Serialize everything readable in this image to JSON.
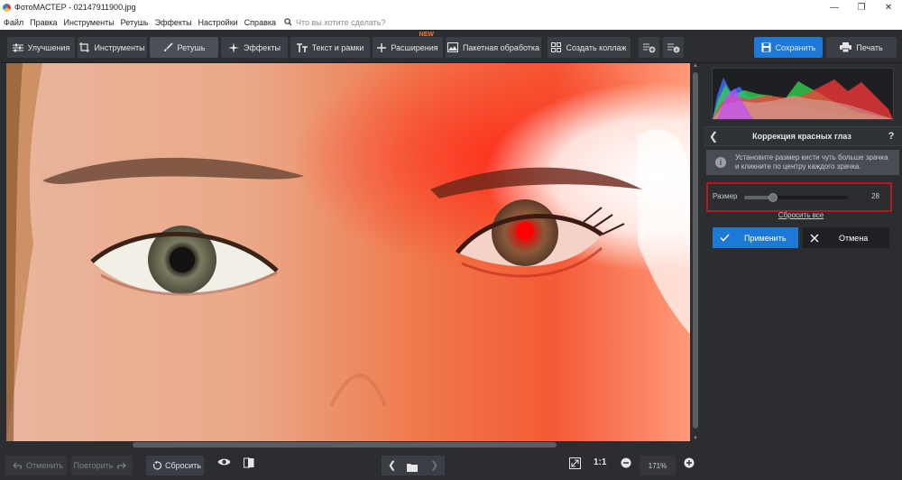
{
  "window": {
    "title": "ФотоМАСТЕР - 02147911900.jpg",
    "controls": [
      "—",
      "❐",
      "✕"
    ]
  },
  "menu": {
    "items": [
      "Файл",
      "Правка",
      "Инструменты",
      "Ретушь",
      "Эффекты",
      "Настройки",
      "Справка"
    ],
    "search_placeholder": "Что вы хотите сделать?"
  },
  "toolbar": {
    "tabs": [
      {
        "label": "Улучшения",
        "icon": "sliders-icon"
      },
      {
        "label": "Инструменты",
        "icon": "crop-icon"
      },
      {
        "label": "Ретушь",
        "icon": "brush-icon"
      },
      {
        "label": "Эффекты",
        "icon": "sparkle-icon"
      },
      {
        "label": "Текст и рамки",
        "icon": "text-icon"
      },
      {
        "label": "Расширения",
        "icon": "plus-icon"
      },
      {
        "label": "Пакетная обработка",
        "icon": "images-icon"
      },
      {
        "label": "Создать коллаж",
        "icon": "grid-icon"
      }
    ],
    "active_tab": "Ретушь",
    "new_badge": "NEW",
    "save_label": "Сохранить",
    "print_label": "Печать"
  },
  "panel": {
    "title": "Коррекция красных глаз",
    "help": "?",
    "info_line1": "Установите размер кисти чуть больше зрачка",
    "info_line2": "и кликните по центру каждого зрачка.",
    "size_label": "Размер",
    "size_value": "28",
    "size_fraction": 0.28,
    "reset_all": "Сбросить все",
    "apply_label": "Применить",
    "cancel_label": "Отмена"
  },
  "bottom": {
    "undo_label": "Отменить",
    "redo_label": "Повторить",
    "reset_label": "Сбросить",
    "one_to_one": "1:1",
    "zoom": "171%"
  },
  "colors": {
    "accent": "#1e78d6",
    "highlight_box": "#c0161b",
    "new_badge": "#ff7a1a"
  }
}
